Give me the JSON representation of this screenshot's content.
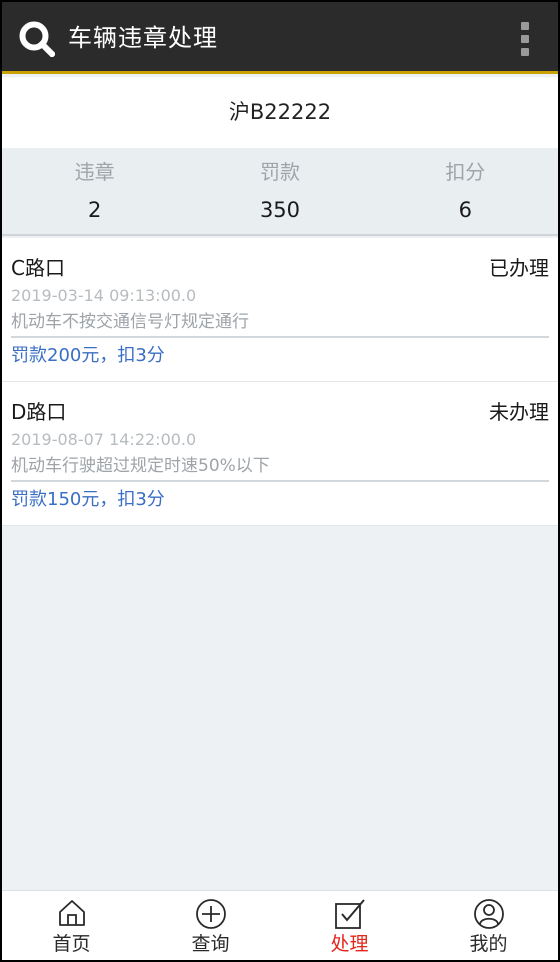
{
  "header": {
    "title": "车辆违章处理",
    "logo_icon": "search-icon",
    "menu_icon": "more-vertical-icon",
    "accent_color": "#c8a200"
  },
  "plate": {
    "number": "沪B22222"
  },
  "summary": {
    "violations_label": "违章",
    "violations_value": "2",
    "fine_label": "罚款",
    "fine_value": "350",
    "points_label": "扣分",
    "points_value": "6"
  },
  "records": [
    {
      "location": "C路口",
      "status": "已办理",
      "time": "2019-03-14 09:13:00.0",
      "description": "机动车不按交通信号灯规定通行",
      "penalty": "罚款200元，扣3分"
    },
    {
      "location": "D路口",
      "status": "未办理",
      "time": "2019-08-07 14:22:00.0",
      "description": "机动车行驶超过规定时速50%以下",
      "penalty": "罚款150元，扣3分"
    }
  ],
  "bottom_nav": {
    "items": [
      {
        "label": "首页",
        "icon": "home-icon"
      },
      {
        "label": "查询",
        "icon": "query-icon"
      },
      {
        "label": "处理",
        "icon": "checkbox-icon",
        "active": true
      },
      {
        "label": "我的",
        "icon": "user-icon"
      }
    ],
    "active_color": "#e5261e"
  }
}
